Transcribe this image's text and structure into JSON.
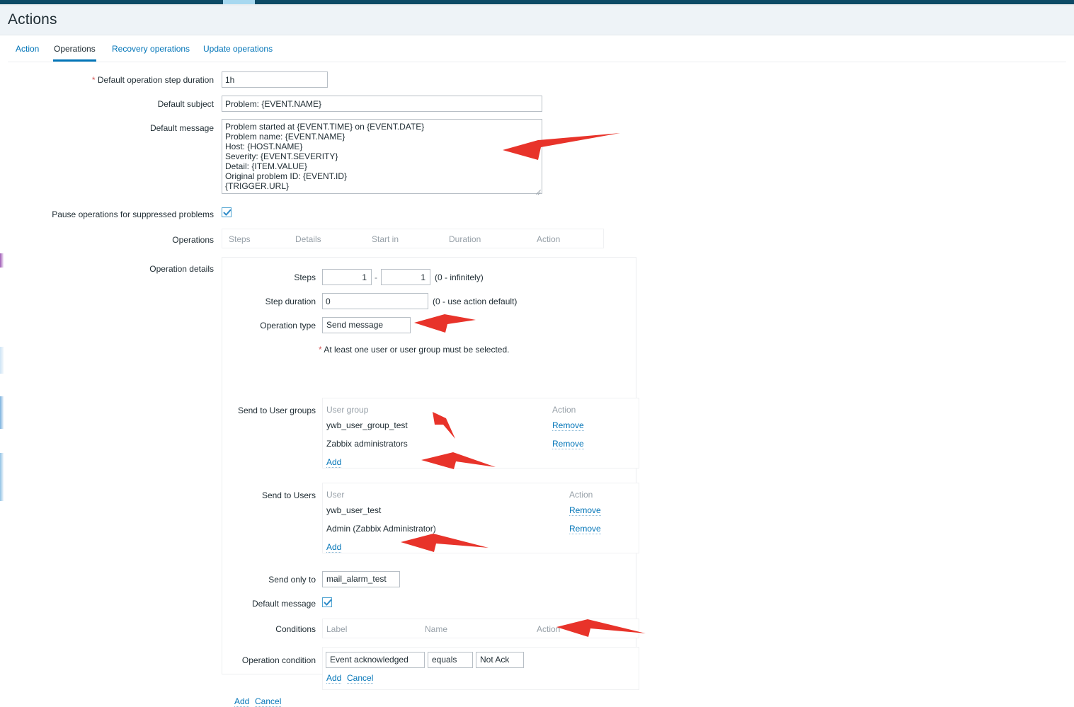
{
  "window": {
    "title": "Actions",
    "accent_color": "#0275b8",
    "topbar_color": "#0d4a66",
    "annotation_color": "#e8332a"
  },
  "tabs": [
    {
      "label": "Action",
      "active": false
    },
    {
      "label": "Operations",
      "active": true
    },
    {
      "label": "Recovery operations",
      "active": false
    },
    {
      "label": "Update operations",
      "active": false
    }
  ],
  "form": {
    "default_step_duration": {
      "label": "Default operation step duration",
      "required_marker": "*",
      "value": "1h"
    },
    "default_subject": {
      "label": "Default subject",
      "value": "Problem: {EVENT.NAME}"
    },
    "default_message": {
      "label": "Default message",
      "value": "Problem started at {EVENT.TIME} on {EVENT.DATE}\nProblem name: {EVENT.NAME}\nHost: {HOST.NAME}\nSeverity: {EVENT.SEVERITY}\nDetail: {ITEM.VALUE}\nOriginal problem ID: {EVENT.ID}\n{TRIGGER.URL}"
    },
    "pause_suppressed": {
      "label": "Pause operations for suppressed problems",
      "checked": true
    },
    "operations": {
      "label": "Operations",
      "columns": [
        "Steps",
        "Details",
        "Start in",
        "Duration",
        "Action"
      ],
      "rows": []
    },
    "operation_details": {
      "label": "Operation details",
      "steps": {
        "label": "Steps",
        "from": "1",
        "to": "1",
        "separator": "-",
        "hint": "(0 - infinitely)"
      },
      "step_duration": {
        "label": "Step duration",
        "value": "0",
        "hint": "(0 - use action default)"
      },
      "operation_type": {
        "label": "Operation type",
        "value": "Send message"
      },
      "validation_note": {
        "star": "*",
        "text": "At least one user or user group must be selected."
      },
      "send_to_user_groups": {
        "label": "Send to User groups",
        "columns": [
          "User group",
          "Action"
        ],
        "rows": [
          {
            "name": "ywb_user_group_test",
            "action": "Remove"
          },
          {
            "name": "Zabbix administrators",
            "action": "Remove"
          }
        ],
        "add_label": "Add"
      },
      "send_to_users": {
        "label": "Send to Users",
        "columns": [
          "User",
          "Action"
        ],
        "rows": [
          {
            "name": "ywb_user_test",
            "action": "Remove"
          },
          {
            "name": "Admin (Zabbix Administrator)",
            "action": "Remove"
          }
        ],
        "add_label": "Add"
      },
      "send_only_to": {
        "label": "Send only to",
        "value": "mail_alarm_test"
      },
      "default_message_checkbox": {
        "label": "Default message",
        "checked": true
      },
      "conditions": {
        "label": "Conditions",
        "columns": [
          "Label",
          "Name",
          "Action"
        ],
        "rows": []
      },
      "operation_condition": {
        "label": "Operation condition",
        "type_value": "Event acknowledged",
        "operator_value": "equals",
        "state_value": "Not Ack",
        "add_label": "Add",
        "cancel_label": "Cancel"
      },
      "footer": {
        "add_label": "Add",
        "cancel_label": "Cancel"
      }
    }
  }
}
